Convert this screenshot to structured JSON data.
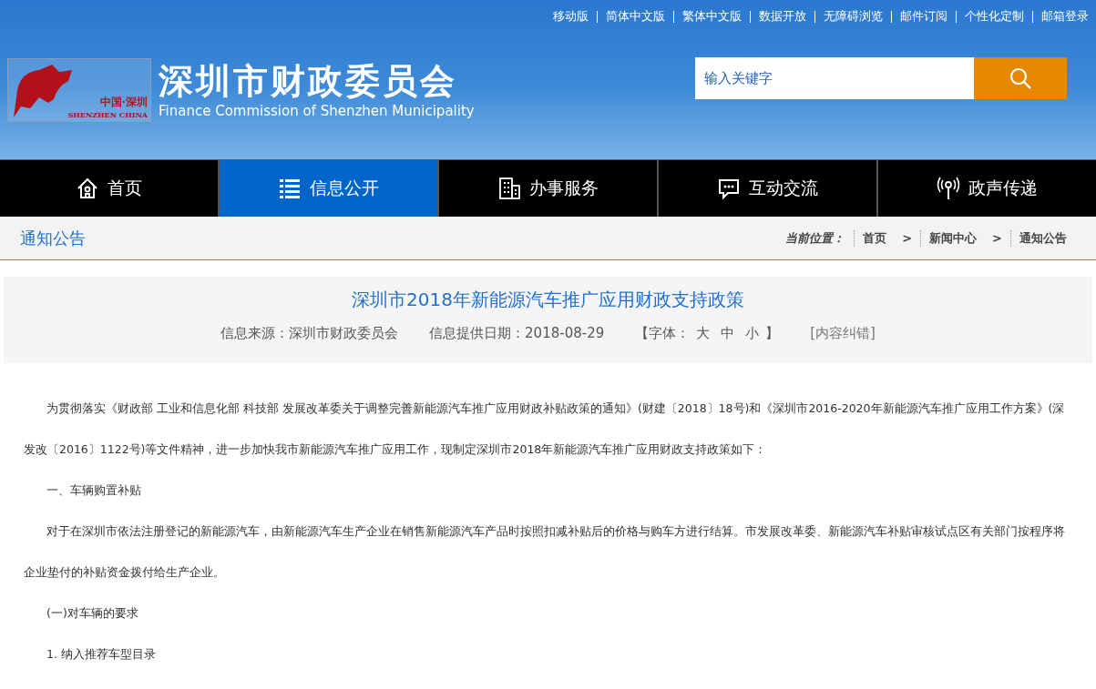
{
  "top_links": [
    "移动版",
    "简体中文版",
    "繁体中文版",
    "数据开放",
    "无障碍浏览",
    "邮件订阅",
    "个性化定制",
    "邮箱登录"
  ],
  "logo": {
    "emblem_cn": "中国·深圳",
    "emblem_en": "SHENZHEN CHINA",
    "title": "深圳市财政委员会",
    "subtitle": "Finance Commission of Shenzhen Municipality"
  },
  "search": {
    "placeholder": "输入关键字"
  },
  "nav": [
    {
      "label": "首页",
      "kind": "home",
      "selected": false
    },
    {
      "label": "信息公开",
      "kind": "list",
      "selected": true
    },
    {
      "label": "办事服务",
      "kind": "building",
      "selected": false
    },
    {
      "label": "互动交流",
      "kind": "chat",
      "selected": false
    },
    {
      "label": "政声传递",
      "kind": "broadcast",
      "selected": false
    }
  ],
  "section_title": "通知公告",
  "breadcrumb": {
    "label": "当前位置：",
    "items": [
      "首页",
      "新闻中心",
      "通知公告"
    ],
    "separators": [
      ">",
      ">"
    ]
  },
  "article": {
    "title": "深圳市2018年新能源汽车推广应用财政支持政策",
    "source": "信息来源：深圳市财政委员会",
    "date": "信息提供日期：2018-08-29",
    "font_label": "【字体：",
    "font_sizes": [
      "大",
      "中",
      "小"
    ],
    "font_close": "】",
    "report": "[内容纠错]",
    "paragraphs": [
      "为贯彻落实《财政部 工业和信息化部 科技部 发展改革委关于调整完善新能源汽车推广应用财政补贴政策的通知》(财建〔2018〕18号)和《深圳市2016-2020年新能源汽车推广应用工作方案》(深发改〔2016〕1122号)等文件精神，进一步加快我市新能源汽车推广应用工作，现制定深圳市2018年新能源汽车推广应用财政支持政策如下：",
      "一、车辆购置补贴",
      "对于在深圳市依法注册登记的新能源汽车，由新能源汽车生产企业在销售新能源汽车产品时按照扣减补贴后的价格与购车方进行结算。市发展改革委、新能源汽车补贴审核试点区有关部门按程序将企业垫付的补贴资金拨付给生产企业。",
      "(一)对车辆的要求",
      "1. 纳入推荐车型目录"
    ]
  }
}
